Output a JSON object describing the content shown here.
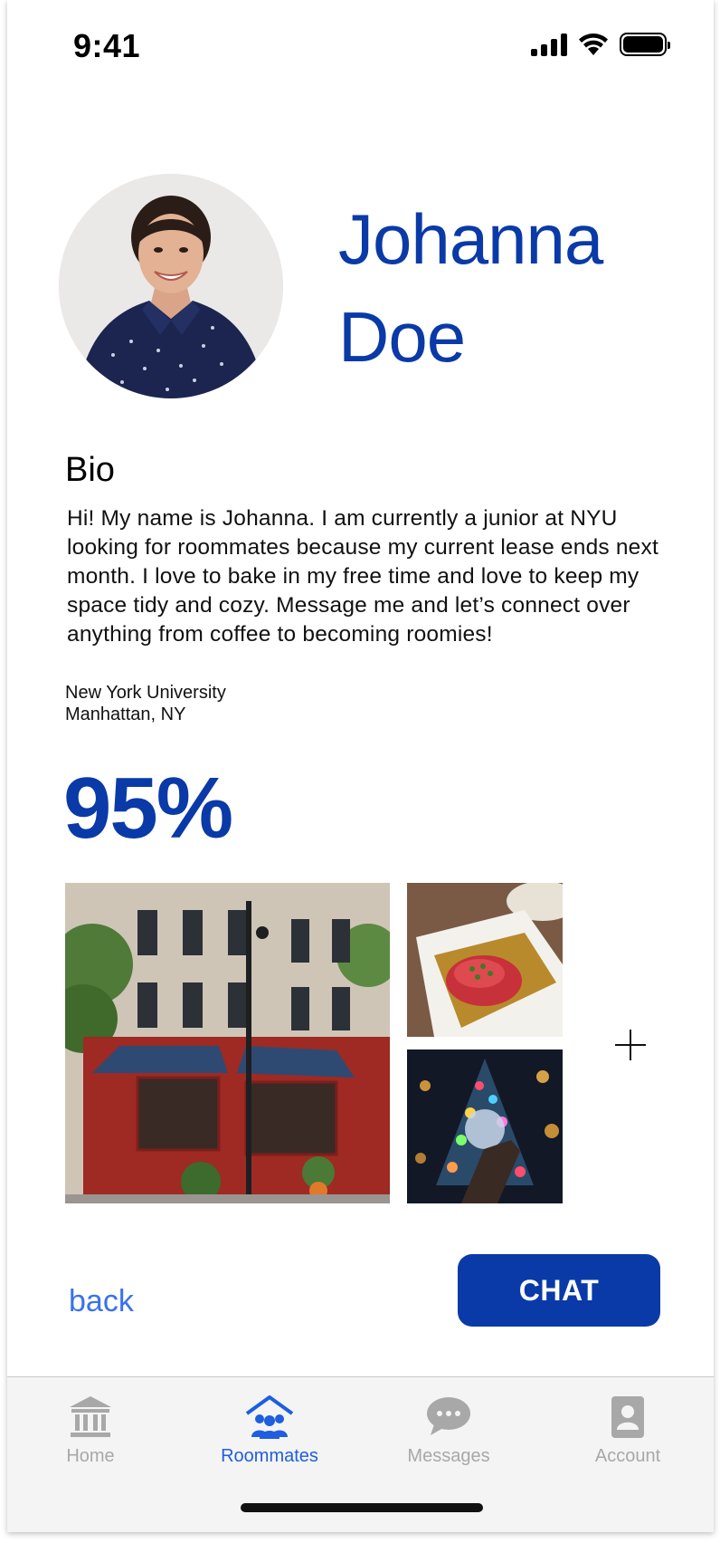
{
  "status_bar": {
    "time": "9:41"
  },
  "profile": {
    "first_name": "Johanna",
    "last_name": "Doe",
    "bio_title": "Bio",
    "bio": "Hi! My name is Johanna. I am currently a junior at NYU looking for roommates because my current lease ends next month. I love to bake in my free time and love to keep my space tidy and cozy. Message me and let’s connect over anything from coffee to becoming roomies!",
    "school": "New York University",
    "location": "Manhattan, NY",
    "match_percent": "95%"
  },
  "actions": {
    "back_label": "back",
    "chat_label": "CHAT"
  },
  "tabs": [
    {
      "label": "Home",
      "icon": "bank-icon",
      "active": false
    },
    {
      "label": "Roommates",
      "icon": "roommates-icon",
      "active": true
    },
    {
      "label": "Messages",
      "icon": "chat-bubble-icon",
      "active": false
    },
    {
      "label": "Account",
      "icon": "contact-card-icon",
      "active": false
    }
  ],
  "colors": {
    "brand": "#0a3aa8",
    "link": "#3a72ec",
    "tab_active": "#1f5ee0",
    "tab_inactive": "#a8a8a8"
  }
}
